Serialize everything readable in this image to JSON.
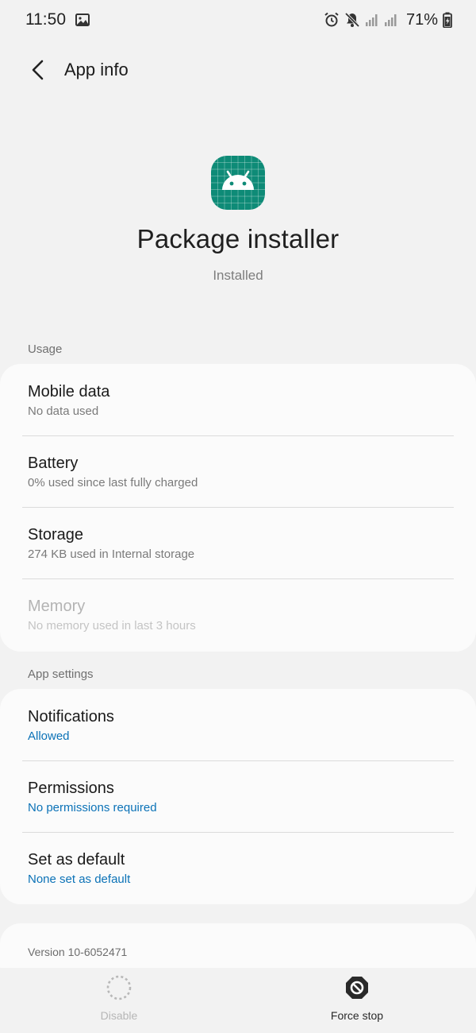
{
  "status_bar": {
    "time": "11:50",
    "battery": "71%",
    "icons": [
      "image-icon",
      "alarm-icon",
      "mute-icon",
      "signal-icon",
      "signal-icon",
      "battery-charging-icon"
    ]
  },
  "header": {
    "title": "App info",
    "back_icon": "chevron-left-icon"
  },
  "app": {
    "name": "Package installer",
    "status": "Installed",
    "icon": "android-icon",
    "icon_color": "#0e8b77"
  },
  "usage": {
    "label": "Usage",
    "rows": [
      {
        "title": "Mobile data",
        "subtitle": "No data used"
      },
      {
        "title": "Battery",
        "subtitle": "0% used since last fully charged"
      },
      {
        "title": "Storage",
        "subtitle": "274 KB used in Internal storage"
      },
      {
        "title": "Memory",
        "subtitle": "No memory used in last 3 hours"
      }
    ]
  },
  "app_settings": {
    "label": "App settings",
    "rows": [
      {
        "title": "Notifications",
        "subtitle": "Allowed"
      },
      {
        "title": "Permissions",
        "subtitle": "No permissions required"
      },
      {
        "title": "Set as default",
        "subtitle": "None set as default"
      }
    ]
  },
  "version": "Version 10-6052471",
  "actions": {
    "disable": "Disable",
    "force_stop": "Force stop"
  },
  "colors": {
    "accent_link": "#0b72b7",
    "background": "#f2f2f2",
    "card": "#fbfbfb"
  }
}
